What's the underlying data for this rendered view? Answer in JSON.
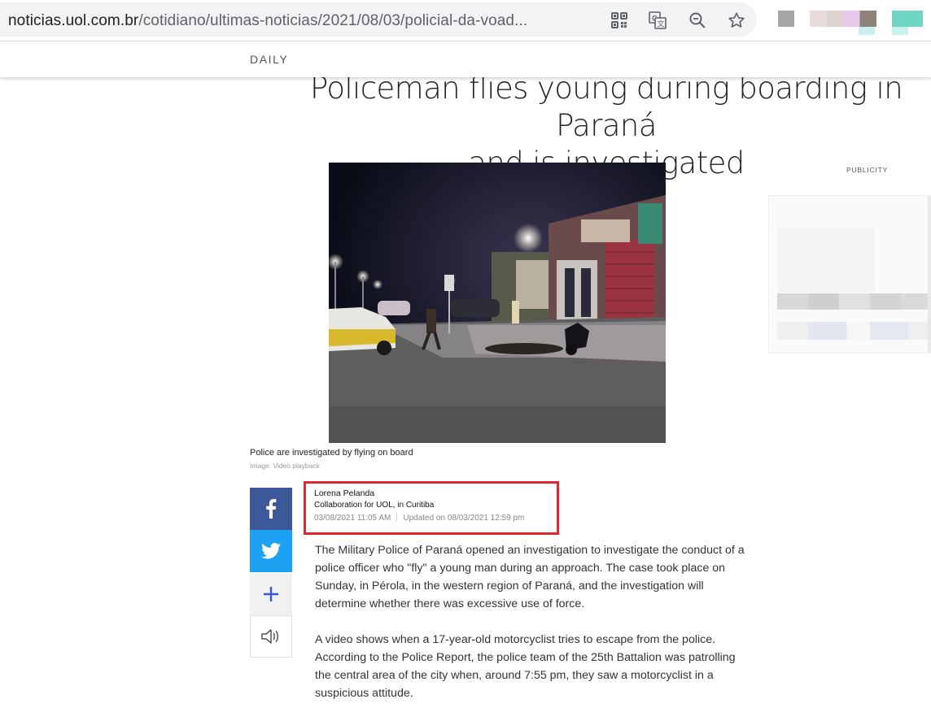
{
  "browser": {
    "url_host": "noticias.uol.com.br",
    "url_path": "/cotidiano/ultimas-noticias/2021/08/03/policial-da-voad..."
  },
  "site": {
    "section": "DAILY"
  },
  "article": {
    "title_line1": "Policeman flies young during boarding in Paraná",
    "title_line2": "and is investigated",
    "photo_caption": "Police are investigated by flying on board",
    "photo_credit": "Image: Video playback",
    "author": "Lorena Pelanda",
    "collaboration": "Collaboration for UOL, in Curitiba",
    "published": "03/08/2021  11:05  AM",
    "updated": "Updated on 08/03/2021  12:59  pm",
    "paragraph1": "The Military Police of Paraná opened an investigation to investigate the conduct of a police officer who \"fly\" a young man during an approach. The case took place on Sunday, in Pérola, in the western region of Paraná, and the investigation will determine whether there was excessive use of force.",
    "paragraph2": "A video shows when a 17-year-old motorcyclist tries to escape from the police. According to the Police Report, the police team of the 25th Battalion was patrolling the central area of the city when, around 7:55 pm, they saw a motorcyclist in a suspicious attitude."
  },
  "ad": {
    "label": "PUBLICITY"
  },
  "colors": {
    "facebook": "#3b5998",
    "twitter": "#1da1f2",
    "highlight": "#e3262b",
    "plus": "#3a55d8"
  },
  "icons": [
    "qr-code-icon",
    "translate-icon",
    "zoom-icon",
    "star-icon",
    "facebook-icon",
    "twitter-icon",
    "plus-icon",
    "speaker-icon"
  ]
}
